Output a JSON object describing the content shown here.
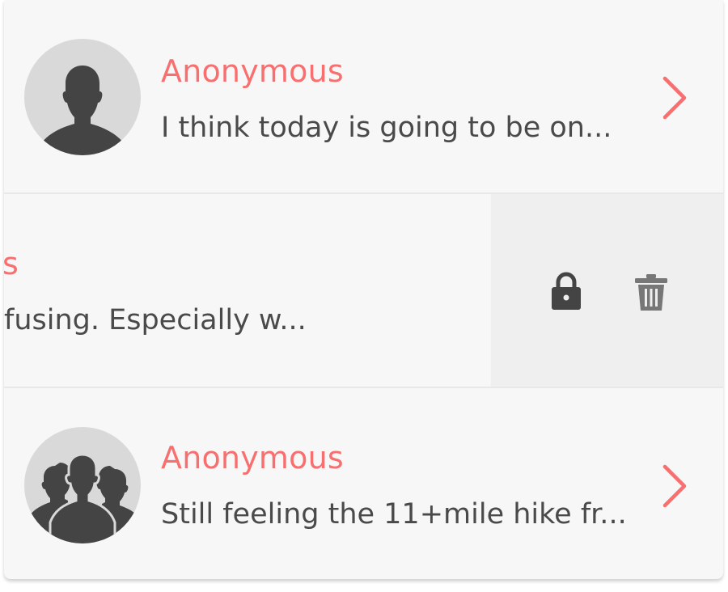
{
  "colors": {
    "accent": "#f86f6f",
    "text": "#4a4a4a",
    "icon_dark": "#444444",
    "icon_gray": "#777777"
  },
  "messages": [
    {
      "name": "Anonymous",
      "preview": "I think today is going to be on...",
      "avatar_icon": "single-person-icon"
    },
    {
      "name": "s",
      "preview": "fusing. Especially w...",
      "swiped": true,
      "actions": [
        "lock-icon",
        "trash-icon"
      ]
    },
    {
      "name": "Anonymous",
      "preview": "Still feeling the 11+mile hike fr...",
      "avatar_icon": "group-icon"
    }
  ]
}
